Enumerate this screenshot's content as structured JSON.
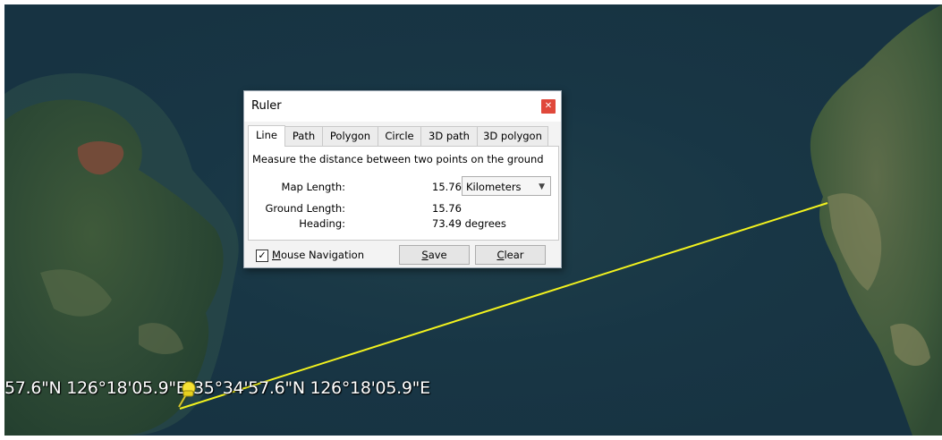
{
  "map": {
    "coord_left": "57.6\"N 126°18'05.9\"E",
    "coord_pin": "35°34'57.6\"N 126°18'05.9\"E",
    "measure_line_color": "#f2f21e",
    "pin_icon": "yellow-pushpin-icon"
  },
  "ruler": {
    "title": "Ruler",
    "close_icon": "close-icon",
    "tabs": [
      {
        "label": "Line",
        "active": true
      },
      {
        "label": "Path"
      },
      {
        "label": "Polygon"
      },
      {
        "label": "Circle"
      },
      {
        "label": "3D path"
      },
      {
        "label": "3D polygon"
      }
    ],
    "description": "Measure the distance between two points on the ground",
    "map_length_label": "Map Length:",
    "map_length_value": "15.76",
    "unit": "Kilometers",
    "ground_length_label": "Ground Length:",
    "ground_length_value": "15.76",
    "heading_label": "Heading:",
    "heading_value": "73.49 degrees",
    "mouse_navigation": {
      "label_m": "M",
      "label_rest": "ouse Navigation",
      "checked": true
    },
    "save": {
      "u": "S",
      "rest": "ave"
    },
    "clear": {
      "u": "C",
      "rest": "lear"
    }
  },
  "colors": {
    "close_button": "#e0483b",
    "water": "#1a3847"
  }
}
